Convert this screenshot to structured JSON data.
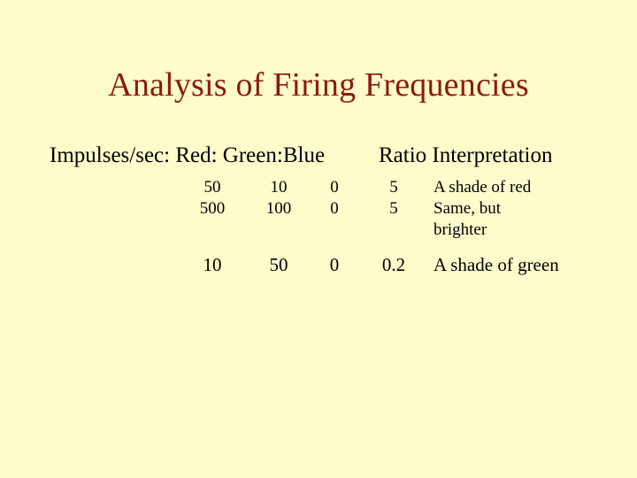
{
  "slide": {
    "title": "Analysis of Firing Frequencies",
    "background_color": "#FFFCCC",
    "title_color": "#8B1A10",
    "body_text_color": "#000000"
  },
  "table": {
    "header": {
      "left": "Impulses/sec: Red: Green:Blue",
      "right": "Ratio Interpretation"
    },
    "columns": [
      "Red",
      "Green",
      "Blue",
      "Ratio",
      "Interpretation"
    ],
    "rows": [
      {
        "red": "50",
        "green": "10",
        "blue": "0",
        "ratio": "5",
        "interpretation_line1": "A shade of red",
        "interpretation_line2": ""
      },
      {
        "red": "500",
        "green": "100",
        "blue": "0",
        "ratio": "5",
        "interpretation_line1": "Same, but",
        "interpretation_line2": "brighter"
      },
      {
        "red": "10",
        "green": "50",
        "blue": "0",
        "ratio": "0.2",
        "interpretation_line1": "A shade of green",
        "interpretation_line2": ""
      }
    ]
  }
}
